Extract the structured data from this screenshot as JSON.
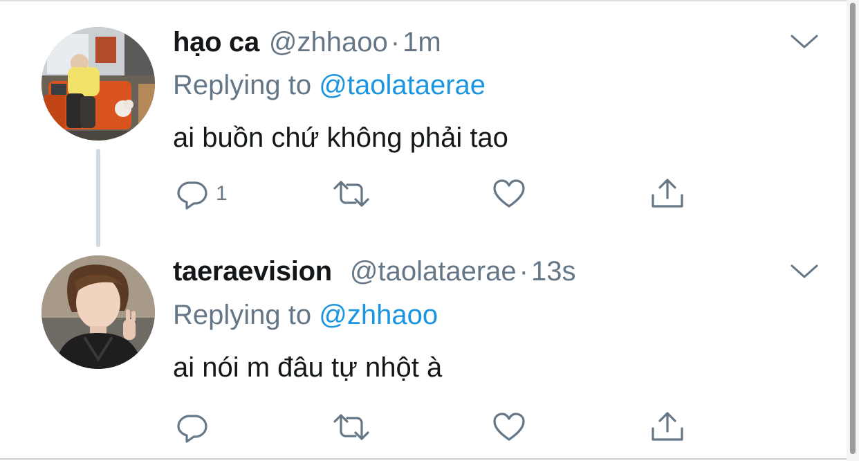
{
  "tweets": [
    {
      "display_name": "hạo ca",
      "handle": "@zhhaoo",
      "separator": "·",
      "time": "1m",
      "replying_prefix": "Replying to",
      "replying_to": "@taolataerae",
      "text": "ai buồn chứ không phải tao",
      "reply_count": "1",
      "retweet_count": "",
      "like_count": "",
      "avatar_icon": "user-photo-avatar"
    },
    {
      "display_name": "taeraevision",
      "handle": "@taolataerae",
      "separator": "·",
      "time": "13s",
      "replying_prefix": "Replying to",
      "replying_to": "@zhhaoo",
      "text": "ai nói m đâu tự nhột à",
      "reply_count": "",
      "retweet_count": "",
      "like_count": "",
      "avatar_icon": "user-photo-avatar"
    }
  ],
  "icons": {
    "reply": "reply-icon",
    "retweet": "retweet-icon",
    "like": "heart-icon",
    "share": "share-icon",
    "more": "chevron-down-icon"
  },
  "colors": {
    "text_primary": "#14171a",
    "text_secondary": "#657786",
    "link": "#1b95e0",
    "icon": "#657786",
    "thread_line": "#cfd9de"
  }
}
